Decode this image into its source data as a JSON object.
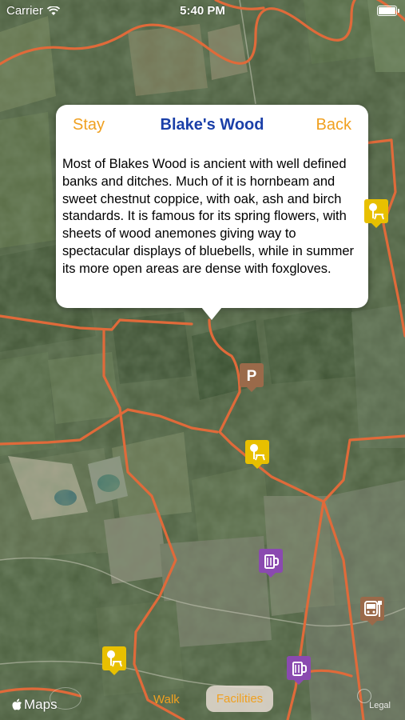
{
  "status_bar": {
    "carrier": "Carrier",
    "time": "5:40 PM"
  },
  "callout": {
    "title": "Blake's Wood",
    "left_button": "Stay",
    "right_button": "Back",
    "description": "Most of Blakes Wood is ancient with well defined banks and ditches. Much of it is hornbeam and sweet chestnut coppice, with oak, ash and birch standards. It is famous for its spring flowers, with sheets of wood anemones giving way to spectacular displays of bluebells, while in summer its more open areas are dense with foxgloves."
  },
  "markers": [
    {
      "name": "picnic-icon",
      "kind": "picnic",
      "color": "#e8c000"
    },
    {
      "name": "parking-icon",
      "kind": "parking",
      "label": "P",
      "color": "#9a6a4a"
    },
    {
      "name": "picnic-icon",
      "kind": "picnic",
      "color": "#e8c000"
    },
    {
      "name": "pub-icon",
      "kind": "pub",
      "color": "#8a4ab0"
    },
    {
      "name": "bus-icon",
      "kind": "bus",
      "color": "#9a6a4a"
    },
    {
      "name": "picnic-icon",
      "kind": "picnic",
      "color": "#e8c000"
    },
    {
      "name": "pub-icon",
      "kind": "pub",
      "color": "#8a4ab0"
    }
  ],
  "bottom_bar": {
    "maps_label": "Maps",
    "walk_label": "Walk",
    "facilities_label": "Facilities",
    "legal_label": "Legal"
  },
  "colors": {
    "accent": "#f0a020",
    "title": "#1a3fa8",
    "route": "#e06a3a"
  }
}
